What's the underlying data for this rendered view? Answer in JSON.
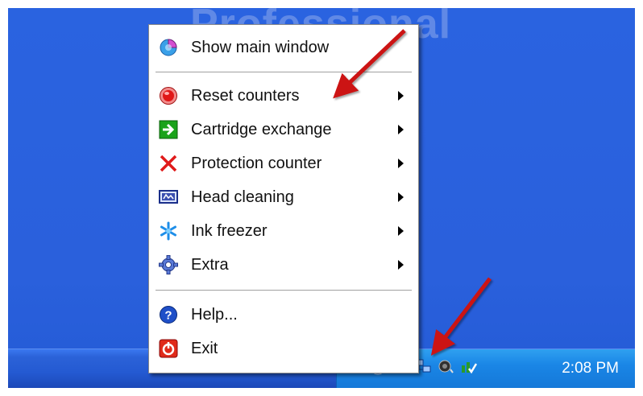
{
  "desktop": {
    "background_text": "Professional"
  },
  "menu": {
    "items": [
      {
        "label": "Show main window",
        "icon": "pie-chart-icon",
        "submenu": false
      },
      {
        "label": "Reset counters",
        "icon": "red-record-icon",
        "submenu": true
      },
      {
        "label": "Cartridge exchange",
        "icon": "green-arrow-icon",
        "submenu": true
      },
      {
        "label": "Protection counter",
        "icon": "red-x-icon",
        "submenu": true
      },
      {
        "label": "Head cleaning",
        "icon": "print-head-icon",
        "submenu": true
      },
      {
        "label": "Ink freezer",
        "icon": "snowflake-icon",
        "submenu": true
      },
      {
        "label": "Extra",
        "icon": "gear-icon",
        "submenu": true
      },
      {
        "label": "Help...",
        "icon": "help-icon",
        "submenu": false
      },
      {
        "label": "Exit",
        "icon": "exit-icon",
        "submenu": false
      }
    ]
  },
  "taskbar": {
    "clock": "2:08 PM",
    "tray_icons": [
      "warning-icon",
      "chevron-left-icon",
      "printer-icon",
      "network-icon",
      "speaker-icon",
      "chart-check-icon"
    ]
  },
  "colors": {
    "desktop": "#2a60dc",
    "taskbar": "#245ad2",
    "tray": "#1a86e6",
    "annotation_arrow": "#cc1414"
  }
}
